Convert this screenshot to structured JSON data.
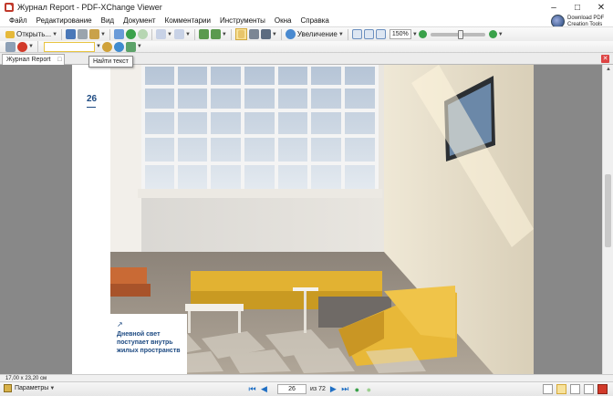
{
  "window": {
    "title": "Журнал Report - PDF-XChange Viewer"
  },
  "ad": {
    "line1": "Download PDF",
    "line2": "Creation Tools"
  },
  "menu": [
    "Файл",
    "Редактирование",
    "Вид",
    "Документ",
    "Комментарии",
    "Инструменты",
    "Окна",
    "Справка"
  ],
  "toolbar": {
    "open_label": "Открыть...",
    "zoom_label": "Увеличение",
    "zoom_value": "150%",
    "find_tooltip": "Найти текст",
    "search_value": ""
  },
  "tab": {
    "label": "Журнал Report"
  },
  "page": {
    "number": "26",
    "caption_arrow": "↗",
    "caption": "Дневной свет поступает внутрь жилых пространств"
  },
  "status": {
    "page_size": "17,00 x 23,20 см"
  },
  "nav": {
    "params_label": "Параметры",
    "current_page": "26",
    "of_label": "из 72"
  },
  "colors": {
    "accent_blue": "#1d4a82",
    "sofa_yellow": "#e8b838"
  }
}
